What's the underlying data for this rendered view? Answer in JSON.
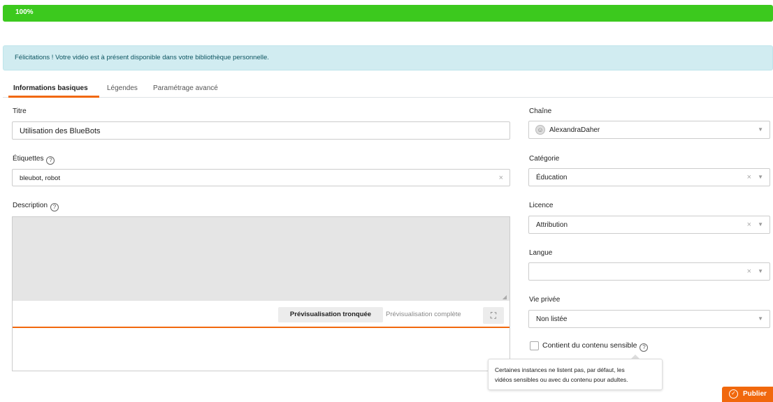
{
  "progress": {
    "label": "100%",
    "percent": 100,
    "color": "#3cc91e"
  },
  "alert": {
    "message": "Félicitations ! Votre vidéo est à présent disponible dans votre bibliothèque personnelle."
  },
  "tabs": [
    {
      "label": "Informations basiques",
      "active": true
    },
    {
      "label": "Légendes",
      "active": false
    },
    {
      "label": "Paramétrage avancé",
      "active": false
    }
  ],
  "form": {
    "title": {
      "label": "Titre",
      "value": "Utilisation des BlueBots"
    },
    "tags": {
      "label": "Étiquettes",
      "value": "bleubot, robot"
    },
    "description": {
      "label": "Description",
      "preview_truncated": "Prévisualisation tronquée",
      "preview_full": "Prévisualisation complète"
    },
    "channel": {
      "label": "Chaîne",
      "value": "AlexandraDaher"
    },
    "category": {
      "label": "Catégorie",
      "value": "Éducation"
    },
    "licence": {
      "label": "Licence",
      "value": "Attribution"
    },
    "language": {
      "label": "Langue",
      "value": ""
    },
    "privacy": {
      "label": "Vie privée",
      "value": "Non listée"
    },
    "sensitive": {
      "label": "Contient du contenu sensible",
      "checked": false,
      "tooltip_line1": "Certaines instances ne listent pas, par défaut, les",
      "tooltip_line2": "vidéos sensibles ou avec du contenu pour adultes."
    }
  },
  "publish": {
    "label": "Publier"
  },
  "colors": {
    "accent": "#f1680d",
    "success": "#3cc91e",
    "info_bg": "#d1ecf1"
  }
}
